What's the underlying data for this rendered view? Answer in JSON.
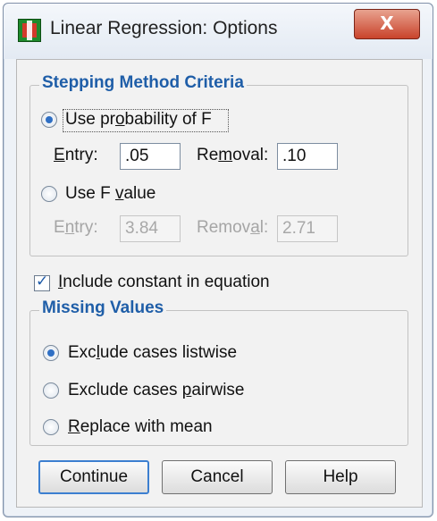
{
  "window": {
    "title": "Linear Regression: Options",
    "close_glyph": "X"
  },
  "stepping": {
    "legend": "Stepping Method Criteria",
    "use_prob": {
      "label": "Use probability of F",
      "checked": true
    },
    "prob_entry_label": "Entry:",
    "prob_entry_value": ".05",
    "prob_removal_label": "Removal:",
    "prob_removal_value": ".10",
    "use_fvalue": {
      "label": "Use F value",
      "checked": false
    },
    "f_entry_label": "Entry:",
    "f_entry_value": "3.84",
    "f_removal_label": "Removal:",
    "f_removal_value": "2.71"
  },
  "include_constant": {
    "label": "Include constant in equation",
    "checked": true
  },
  "missing": {
    "legend": "Missing Values",
    "options": [
      {
        "label": "Exclude cases listwise",
        "checked": true
      },
      {
        "label": "Exclude cases pairwise",
        "checked": false
      },
      {
        "label": "Replace with mean",
        "checked": false
      }
    ]
  },
  "buttons": {
    "continue": "Continue",
    "cancel": "Cancel",
    "help": "Help"
  },
  "colors": {
    "legend_text": "#1f5ea8",
    "close_button": "#c9432b",
    "default_button_border": "#3c7fd0"
  }
}
